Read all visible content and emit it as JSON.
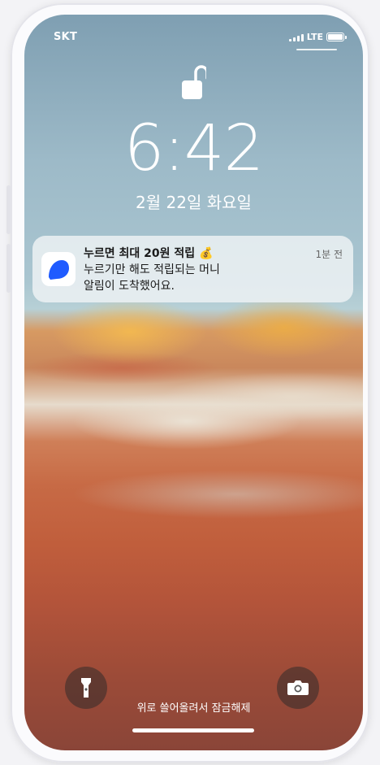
{
  "status_bar": {
    "carrier": "SKT",
    "network": "LTE",
    "icons": [
      "signal-icon",
      "battery-icon"
    ]
  },
  "lock_screen": {
    "lock_icon": "unlocked-padlock-icon",
    "time": "6:42",
    "date": "2월 22일 화요일"
  },
  "notification": {
    "title": "누르면 최대 20원 적립 💰",
    "time_ago": "1분 전",
    "body_line1": "누르기만 해도 적립되는 머니",
    "body_line2": "알림이 도착했어요.",
    "app_icon": "blue-speech-bubble-app-icon"
  },
  "bottom": {
    "flashlight_icon": "flashlight-icon",
    "camera_icon": "camera-icon",
    "hint": "위로 쓸어올려서 잠금해제"
  },
  "colors": {
    "app_accent": "#1f5bff",
    "notification_bg": "#ecf1f3"
  }
}
